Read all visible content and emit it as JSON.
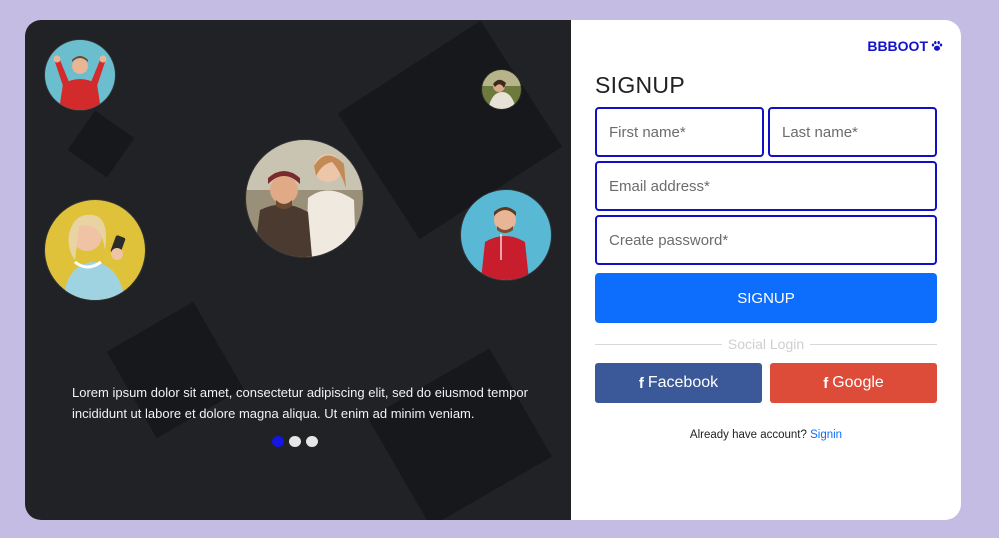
{
  "hero": {
    "quote": "Lorem ipsum dolor sit amet, consectetur adipiscing elit, sed do eiusmod tempor incididunt ut labore et dolore magna aliqua. Ut enim ad minim veniam.",
    "slides": 3,
    "active_slide": 1
  },
  "brand": {
    "name": "BBBOOT",
    "icon": "paw-icon",
    "color": "#1212cc"
  },
  "form": {
    "title": "SIGNUP",
    "first_name_placeholder": "First name*",
    "last_name_placeholder": "Last name*",
    "email_placeholder": "Email address*",
    "password_placeholder": "Create password*",
    "submit_label": "SIGNUP"
  },
  "social": {
    "divider_label": "Social Login",
    "facebook": {
      "icon": "f",
      "label": "Facebook"
    },
    "google": {
      "icon": "f",
      "label": "Google"
    }
  },
  "account": {
    "prompt": "Already have account?",
    "link_label": "Signin"
  },
  "colors": {
    "page_bg": "#c4bce2",
    "panel_dark": "#202226",
    "field_border": "#1010c8",
    "primary": "#0d6efd",
    "facebook": "#3b5998",
    "google": "#dd4b39"
  }
}
